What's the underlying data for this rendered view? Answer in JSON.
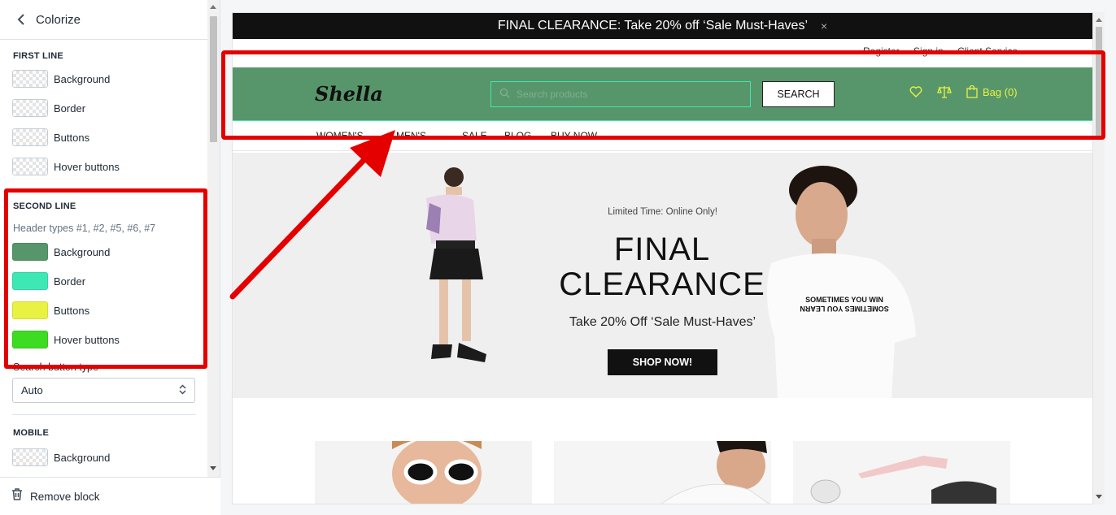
{
  "sidebar": {
    "title": "Colorize",
    "first_line": {
      "heading": "FIRST LINE",
      "items": [
        {
          "label": "Background",
          "color": "transparent"
        },
        {
          "label": "Border",
          "color": "transparent"
        },
        {
          "label": "Buttons",
          "color": "transparent"
        },
        {
          "label": "Hover buttons",
          "color": "transparent"
        }
      ]
    },
    "second_line": {
      "heading": "SECOND LINE",
      "helper": "Header types #1, #2, #5, #6, #7",
      "items": [
        {
          "label": "Background",
          "color": "#57966a"
        },
        {
          "label": "Border",
          "color": "#3de8b4"
        },
        {
          "label": "Buttons",
          "color": "#e9f243"
        },
        {
          "label": "Hover buttons",
          "color": "#3ddc22"
        }
      ]
    },
    "search_button_type": {
      "label": "Search button type",
      "value": "Auto"
    },
    "mobile": {
      "heading": "MOBILE",
      "items": [
        {
          "label": "Background",
          "color": "transparent"
        }
      ]
    },
    "footer": {
      "remove_label": "Remove block"
    }
  },
  "preview": {
    "promo_text": "FINAL CLEARANCE: Take 20% off ‘Sale Must-Haves’",
    "promo_close": "×",
    "top_links": [
      "Register",
      "Sign in",
      "Client Service"
    ],
    "logo": "Shella",
    "search_placeholder": "Search products",
    "search_button": "SEARCH",
    "bag_label": "Bag (0)",
    "nav": [
      "WOMEN'S",
      "MEN'S",
      "SALE",
      "BLOG",
      "BUY NOW"
    ],
    "hero": {
      "small": "Limited Time: Online Only!",
      "title": "FINAL CLEARANCE",
      "subtitle": "Take 20% Off ‘Sale Must-Haves’",
      "button": "SHOP NOW!",
      "tshirt_text": "SOMETIMES YOU WIN"
    }
  },
  "colors": {
    "highlight": "#e50000",
    "header_bg": "#57966a"
  }
}
